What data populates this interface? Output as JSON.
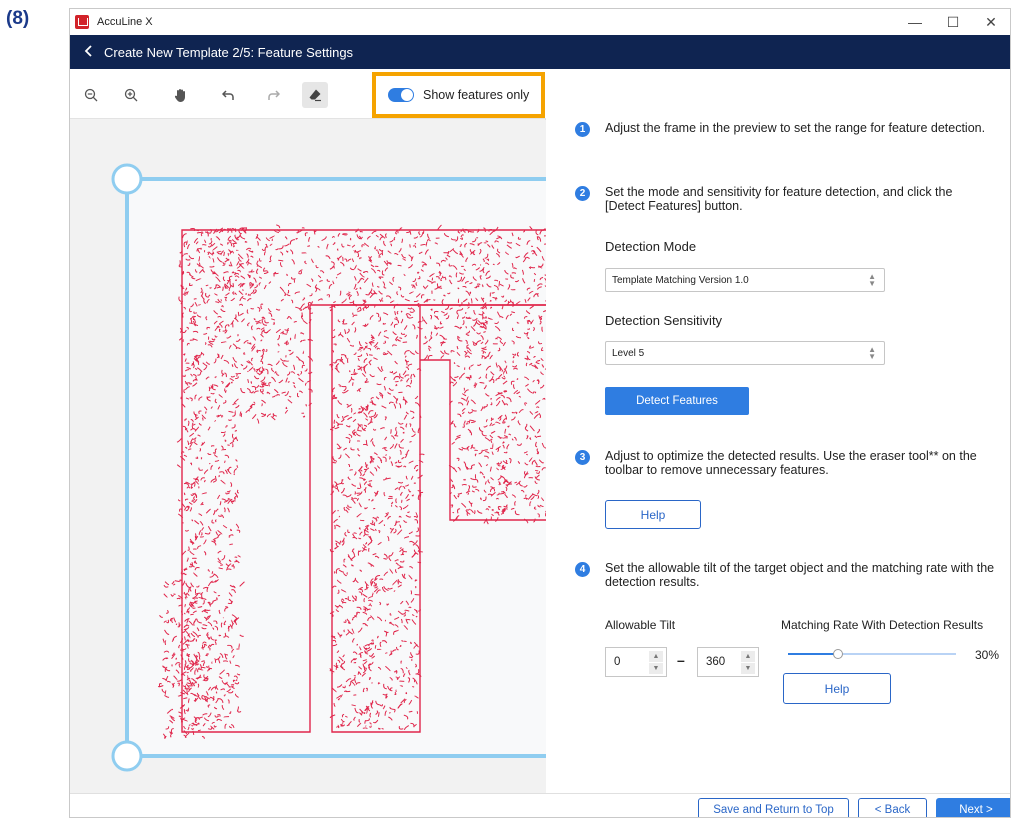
{
  "step_marker": "(8)",
  "window": {
    "app_title": "AccuLine X",
    "controls": {
      "minimize": "—",
      "maximize": "☐",
      "close": "✕"
    }
  },
  "nav": {
    "back_icon": "chevron-left-icon",
    "title": "Create New Template 2/5: Feature Settings"
  },
  "toolbar": {
    "tools": [
      "zoom-out-icon",
      "zoom-in-icon",
      "hand-icon",
      "undo-icon",
      "redo-icon",
      "eraser-icon"
    ],
    "toggle_label": "Show features only",
    "toggle_on": true,
    "highlight_color": "#f5a300"
  },
  "steps": [
    {
      "num": "1",
      "text": "Adjust the frame in the preview to set the range for feature detection."
    },
    {
      "num": "2",
      "text": "Set the mode and sensitivity for feature detection, and click the [Detect Features] button."
    },
    {
      "num": "3",
      "text": "Adjust to optimize the detected results. Use the eraser tool** on the toolbar to remove unnecessary features."
    },
    {
      "num": "4",
      "text": "Set the allowable tilt of the target object and the matching rate with the detection results."
    }
  ],
  "detection_mode": {
    "label": "Detection Mode",
    "value": "Template Matching Version 1.0"
  },
  "detection_sensitivity": {
    "label": "Detection Sensitivity",
    "value": "Level 5"
  },
  "detect_button": "Detect Features",
  "help_button": "Help",
  "tilt": {
    "label": "Allowable Tilt",
    "min": "0",
    "dash": "–",
    "max": "360"
  },
  "matching": {
    "label": "Matching Rate With Detection Results",
    "value_text": "30%",
    "value": 0.3
  },
  "footer": {
    "save_return": "Save and Return to Top",
    "back": "< Back",
    "next": "Next >"
  },
  "colors": {
    "accent": "#2f7de1",
    "navbar": "#0f2451",
    "feature": "#e0264b",
    "frame": "#8fcdf0"
  }
}
